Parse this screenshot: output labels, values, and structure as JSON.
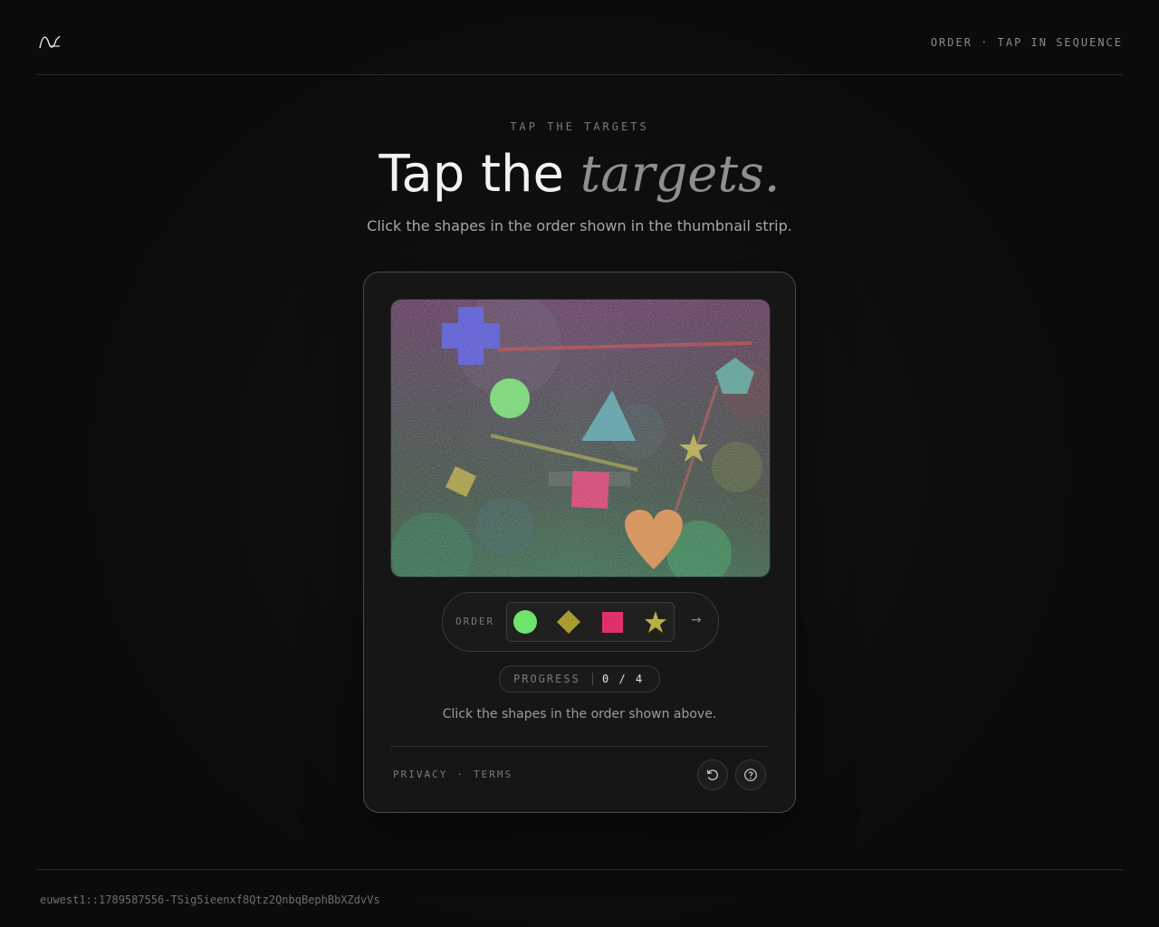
{
  "header": {
    "logo_icon": "wave-logo-icon",
    "mode_text": "ORDER · TAP IN SEQUENCE"
  },
  "hero": {
    "eyebrow": "TAP THE TARGETS",
    "title_plain": "Tap the ",
    "title_italic": "targets.",
    "subtitle": "Click the shapes in the order shown in the thumbnail strip."
  },
  "challenge": {
    "canvas_shapes": [
      "cross",
      "circle",
      "triangle",
      "pentagon",
      "star",
      "diamond",
      "square",
      "heart"
    ],
    "order_label": "ORDER",
    "order_items": [
      "green-circle",
      "olive-diamond",
      "pink-square",
      "olive-star"
    ],
    "order_arrow": "→",
    "progress_label": "PROGRESS",
    "progress_value": "0 / 4",
    "progress_done": 0,
    "progress_total": 4,
    "instruction": "Click the shapes in the order shown above."
  },
  "card_footer": {
    "privacy": "PRIVACY",
    "separator": "·",
    "terms": "TERMS",
    "refresh_icon": "refresh-icon",
    "help_icon": "help-icon"
  },
  "footer": {
    "session_id": "euwest1::1789587556-TSig5ieenxf8Qtz2QnbqBephBbXZdvVs"
  },
  "colors": {
    "background": "#0c0c0c",
    "card": "#161616",
    "shape_green": "#6fe36b",
    "shape_blue": "#4a4ae0",
    "shape_teal": "#4fa0a0",
    "shape_olive": "#a89c30",
    "shape_pink": "#e0306a",
    "shape_orange": "#e08a40"
  }
}
